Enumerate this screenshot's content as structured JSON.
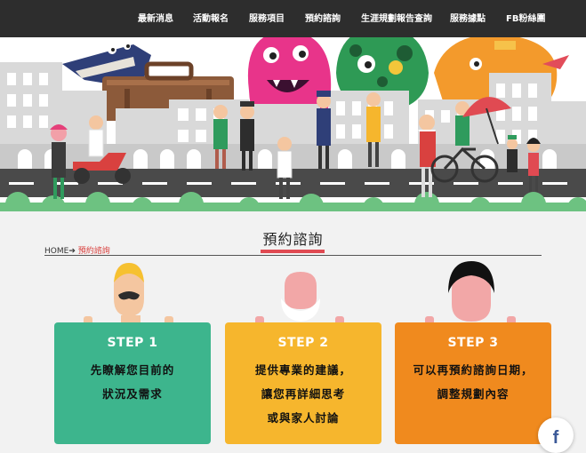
{
  "nav": {
    "items": [
      {
        "label": "最新消息"
      },
      {
        "label": "活動報名"
      },
      {
        "label": "服務項目"
      },
      {
        "label": "預約諮詢"
      },
      {
        "label": "生涯規劃報告查詢"
      },
      {
        "label": "服務據點"
      },
      {
        "label": "FB粉絲團"
      }
    ]
  },
  "page": {
    "title": "預約諮詢"
  },
  "breadcrumb": {
    "home": "HOME",
    "separator": "➔",
    "current": "預約諮詢"
  },
  "steps": [
    {
      "title": "STEP 1",
      "lines": [
        "先瞭解您目前的",
        "狀況及需求"
      ],
      "color": "#3db58d"
    },
    {
      "title": "STEP 2",
      "lines": [
        "提供專業的建議，",
        "讓您再詳細思考",
        "或與家人討論"
      ],
      "color": "#f6b62d"
    },
    {
      "title": "STEP 3",
      "lines": [
        "可以再預約諮詢日期，",
        "調整規劃內容"
      ],
      "color": "#f08a1e"
    }
  ],
  "colors": {
    "nav_bg": "#2d2d2d",
    "accent": "#e04a52",
    "step1": "#3db58d",
    "step2": "#f6b62d",
    "step3": "#f08a1e",
    "facebook": "#3b5998"
  },
  "icons": {
    "facebook": "facebook-icon",
    "arrow": "arrow-right-icon"
  }
}
